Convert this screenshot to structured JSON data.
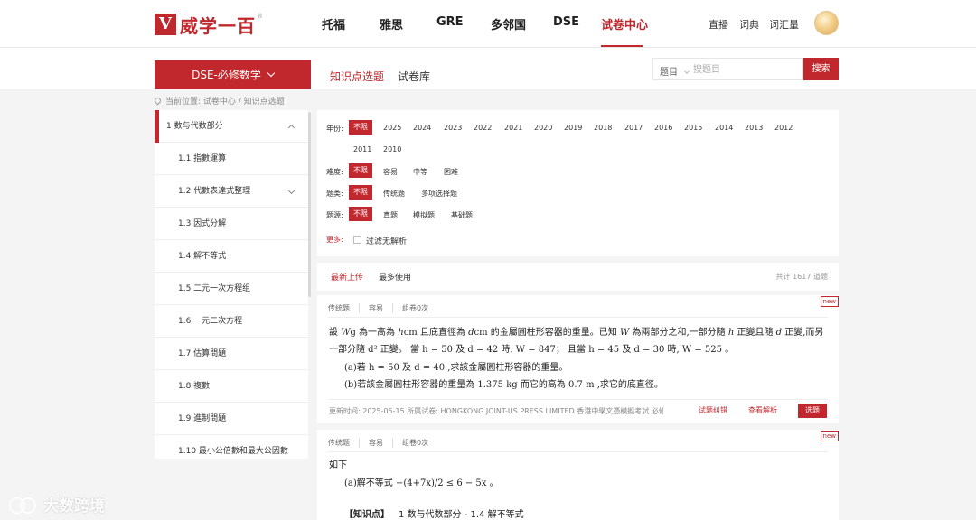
{
  "header": {
    "logo_text": "威学一百",
    "logo_mark": "V",
    "logo_reg": "®",
    "nav": [
      "托福",
      "雅思",
      "GRE",
      "多邻国",
      "DSE",
      "试卷中心"
    ],
    "nav_active": "试卷中心",
    "right_links": [
      "直播",
      "词典",
      "词汇量"
    ]
  },
  "subbar": {
    "subject": "DSE-必修数学",
    "tabs": [
      "知识点选题",
      "试卷库"
    ],
    "search_type": "题目",
    "search_placeholder": "搜题目",
    "search_button": "搜索"
  },
  "breadcrumb": "当前位置: 试卷中心 / 知识点选题",
  "sidebar": {
    "items": [
      "1 数与代数部分",
      "1.1 指數運算",
      "1.2 代數表達式整理",
      "1.3 因式分解",
      "1.4 解不等式",
      "1.5 二元一次方程组",
      "1.6 一元二次方程",
      "1.7 估算問題",
      "1.8 複數",
      "1.9 進制問題",
      "1.10 最小公倍數和最大公因數"
    ]
  },
  "filters": {
    "year_label": "年份:",
    "years": [
      "不限",
      "2025",
      "2024",
      "2023",
      "2022",
      "2021",
      "2020",
      "2019",
      "2018",
      "2017",
      "2016",
      "2015",
      "2014",
      "2013",
      "2012",
      "2011",
      "2010"
    ],
    "difficulty_label": "难度:",
    "difficulty": [
      "不限",
      "容易",
      "中等",
      "困难"
    ],
    "type_label": "题类:",
    "types": [
      "不限",
      "传统题",
      "多项选择题"
    ],
    "source_label": "题源:",
    "sources": [
      "不限",
      "真题",
      "模拟题",
      "基础题"
    ],
    "more_label": "更多:",
    "checkbox_label": "过滤无解析"
  },
  "sortbar": {
    "tabs": [
      "最新上传",
      "最多使用"
    ],
    "total": "共计 1617 道题"
  },
  "questions": [
    {
      "meta": [
        "传统题",
        "容易",
        "组卷0次"
      ],
      "badge": "new",
      "line1_a": "設 ",
      "line1_b": "W",
      "line1_c": "g 為一高為 ",
      "line1_d": "h",
      "line1_e": "cm 且底直徑為 ",
      "line1_f": "d",
      "line1_g": "cm 的金屬圓柱形容器的重量。已知 ",
      "line1_h": "W",
      "line1_i": " 為兩部分之和,一部分隨 ",
      "line1_j": "h",
      "line1_k": " 正變且隨 ",
      "line1_l": "d",
      "line1_m": " 正變,而另",
      "line2": "一部分隨 d² 正變。 當 h = 50 及 d = 42 時, W = 847； 且當 h = 45 及 d = 30 時, W = 525 。",
      "part_a": "(a)若 h = 50 及 d = 40 ,求該金屬圓柱形容器的重量。",
      "part_b": "(b)若該金屬圓柱形容器的重量為 1.375 kg 而它的高為 0.7 m ,求它的底直徑。",
      "updated": "更新时间:  2025-05-15     所属试卷:  HONGKONG JOINT-US PRESS LIMITED 香港中學文憑模擬考試 必修...",
      "actions": [
        "试题纠错",
        "查看解析",
        "选题"
      ]
    },
    {
      "meta": [
        "传统题",
        "容易",
        "组卷0次"
      ],
      "badge": "new",
      "intro": "如下",
      "part_a": "(a)解不等式 −(4+7x)/2 ≤ 6 − 5x 。",
      "kp_label": "【知识点】",
      "kp_value": "1 数与代数部分 - 1.4 解不等式"
    }
  ],
  "watermark": "大数跨境"
}
